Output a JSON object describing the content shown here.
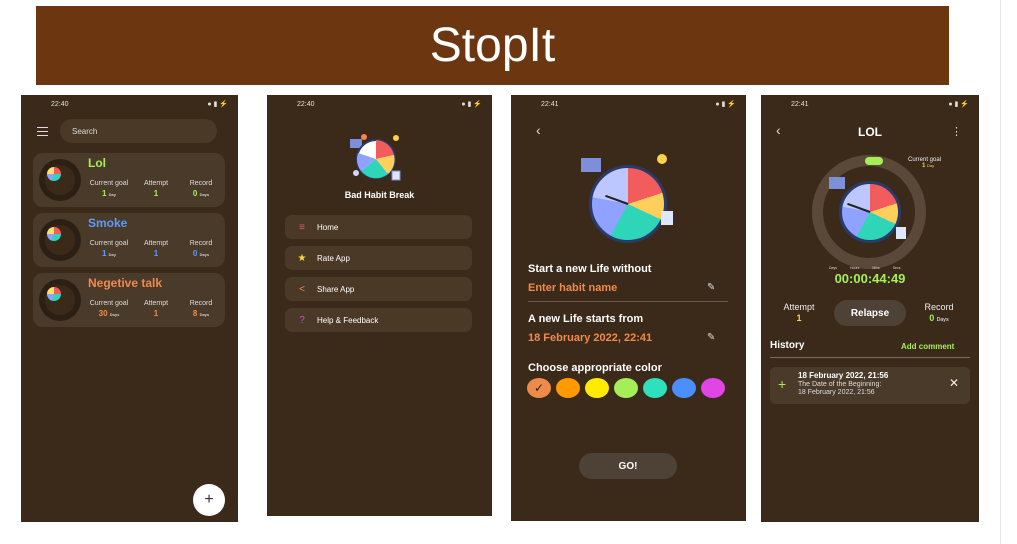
{
  "banner": {
    "title": "StopIt"
  },
  "phone1": {
    "status_time": "22:40",
    "search_placeholder": "Search",
    "habits": [
      {
        "name": "Lol",
        "color": "#a4ef58",
        "stats": [
          {
            "label": "Current goal",
            "value": "1",
            "unit": "Day"
          },
          {
            "label": "Attempt",
            "value": "1",
            "unit": ""
          },
          {
            "label": "Record",
            "value": "0",
            "unit": "Days"
          }
        ]
      },
      {
        "name": "Smoke",
        "color": "#5b9bff",
        "stats": [
          {
            "label": "Current goal",
            "value": "1",
            "unit": "Day"
          },
          {
            "label": "Attempt",
            "value": "1",
            "unit": ""
          },
          {
            "label": "Record",
            "value": "0",
            "unit": "Days"
          }
        ]
      },
      {
        "name": "Negetive talk",
        "color": "#f08a4b",
        "stats": [
          {
            "label": "Current goal",
            "value": "30",
            "unit": "Days"
          },
          {
            "label": "Attempt",
            "value": "1",
            "unit": ""
          },
          {
            "label": "Record",
            "value": "8",
            "unit": "Days"
          }
        ]
      }
    ],
    "fab_label": "+"
  },
  "phone2": {
    "status_time": "22:40",
    "app_name": "Bad Habit Break",
    "menu": [
      {
        "label": "Home",
        "icon": "list-icon",
        "glyph": "≡",
        "color": "#e05a6a"
      },
      {
        "label": "Rate App",
        "icon": "star-icon",
        "glyph": "★",
        "color": "#ffd83b"
      },
      {
        "label": "Share App",
        "icon": "share-icon",
        "glyph": "<",
        "color": "#f08a4b"
      },
      {
        "label": "Help & Feedback",
        "icon": "help-icon",
        "glyph": "?",
        "color": "#d546d6"
      }
    ]
  },
  "phone3": {
    "status_time": "22:41",
    "start_label": "Start a new Life without",
    "habit_placeholder": "Enter habit name",
    "starts_label": "A new Life starts from",
    "start_date": "18 February 2022, 22:41",
    "color_label": "Choose appropriate color",
    "colors": [
      "#f08a4b",
      "#ff9a00",
      "#ffeb00",
      "#a4ef58",
      "#2fe0bf",
      "#4b8eff",
      "#e045e6"
    ],
    "selected_mark": "✓",
    "go_label": "GO!"
  },
  "phone4": {
    "status_time": "22:41",
    "title": "LOL",
    "current_goal_label": "Current goal",
    "current_goal_value": "1",
    "current_goal_unit": "Day",
    "time_units": [
      "Days",
      "Hours",
      "Mins",
      "Secs"
    ],
    "timer": "00:00:44:49",
    "attempt_label": "Attempt",
    "attempt_value": "1",
    "relapse_label": "Relapse",
    "record_label": "Record",
    "record_value": "0",
    "record_unit": "Days",
    "history_label": "History",
    "add_comment_label": "Add comment",
    "history_item": {
      "title": "18 February 2022, 21:56",
      "line1": "The Date of the Beginning:",
      "line2": "18 February 2022, 21:56"
    }
  }
}
